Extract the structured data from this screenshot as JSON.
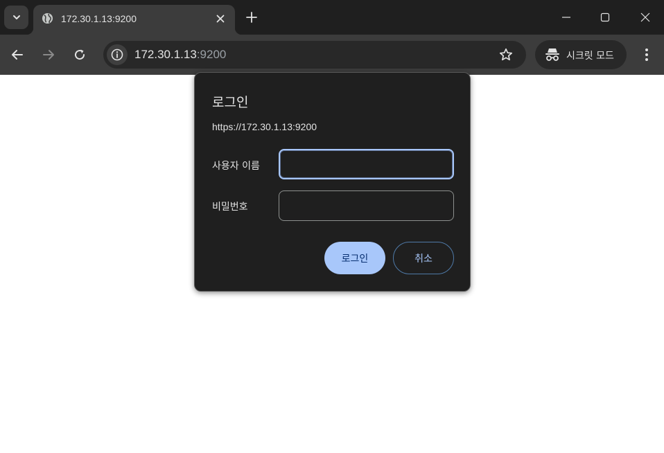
{
  "tab": {
    "title": "172.30.1.13:9200",
    "favicon": "globe-icon",
    "close_icon": "close-icon"
  },
  "tabstrip": {
    "tab_search_icon": "chevron-down-icon",
    "new_tab_icon": "plus-icon",
    "window_controls": [
      "minimize-icon",
      "maximize-icon",
      "close-icon"
    ]
  },
  "toolbar": {
    "url_host": "172.30.1.13",
    "url_port": ":9200",
    "incognito_label": "시크릿 모드",
    "icons": [
      "back-arrow-icon",
      "forward-arrow-icon",
      "reload-icon",
      "info-icon",
      "star-icon",
      "incognito-icon",
      "kebab-menu-icon"
    ]
  },
  "dialog": {
    "title": "로그인",
    "origin": "https://172.30.1.13:9200",
    "username_label": "사용자 이름",
    "username_value": "",
    "password_label": "비밀번호",
    "password_value": "",
    "login_button": "로그인",
    "cancel_button": "취소"
  },
  "colors": {
    "chrome_dark": "#1f1f1f",
    "toolbar": "#3c3c3c",
    "accent": "#a8c7fa",
    "text": "#e3e3e3"
  }
}
